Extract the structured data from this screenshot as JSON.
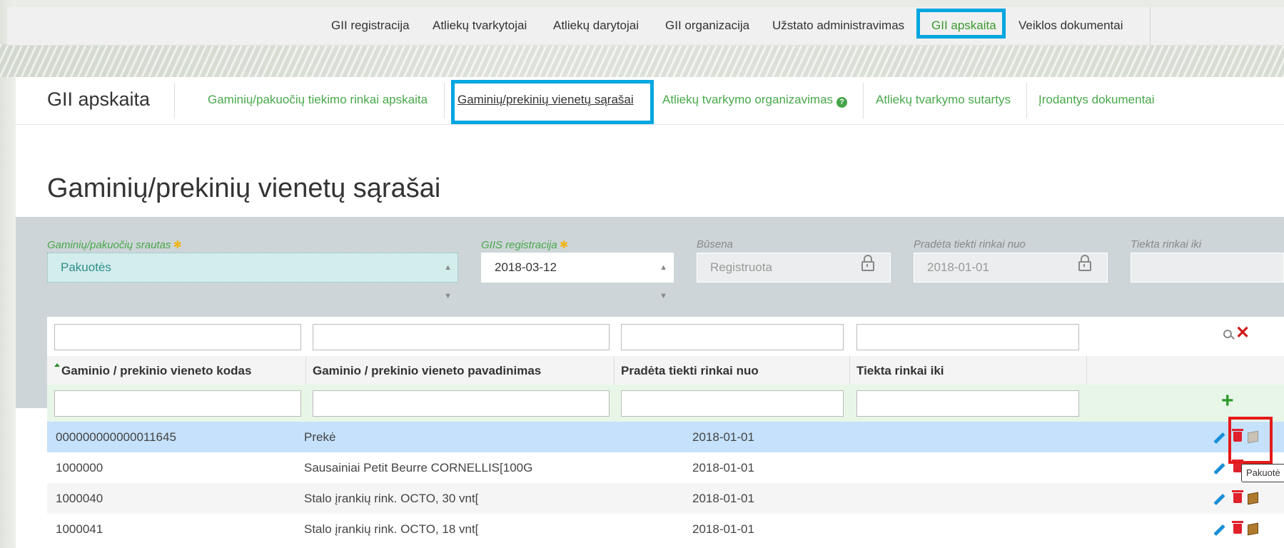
{
  "topnav": {
    "items": [
      {
        "label": "GII registracija"
      },
      {
        "label": "Atliekų tvarkytojai"
      },
      {
        "label": "Atliekų darytojai"
      },
      {
        "label": "GII organizacija"
      },
      {
        "label": "Užstato administravimas"
      },
      {
        "label": "GII apskaita",
        "active": true
      },
      {
        "label": "Veiklos dokumentai"
      }
    ]
  },
  "subnav": {
    "title": "GII apskaita",
    "items": [
      {
        "label": "Gaminių/pakuočių tiekimo rinkai apskaita"
      },
      {
        "label": "Gaminių/prekinių vienetų sąrašai",
        "current": true
      },
      {
        "label": "Atliekų tvarkymo organizavimas"
      },
      {
        "label": "Atliekų tvarkymo sutartys"
      },
      {
        "label": "Įrodantys dokumentai"
      }
    ],
    "help_badge": "?"
  },
  "page": {
    "title": "Gaminių/prekinių vienetų sąrašai"
  },
  "filters": {
    "stream": {
      "label": "Gaminių/pakuočių srautas",
      "value": "Pakuotės",
      "required_mark": "✱"
    },
    "registration": {
      "label": "GIIS registracija",
      "value": "2018-03-12",
      "required_mark": "✱"
    },
    "status": {
      "label": "Būsena",
      "value": "Registruota"
    },
    "supplied_from": {
      "label": "Pradėta tiekti rinkai nuo",
      "value": "2018-01-01"
    },
    "supplied_to": {
      "label": "Tiekta rinkai iki",
      "value": ""
    }
  },
  "table": {
    "columns": [
      "Gaminio / prekinio vieneto kodas",
      "Gaminio / prekinio vieneto pavadinimas",
      "Pradėta tiekti rinkai nuo",
      "Tiekta rinkai iki"
    ],
    "add_symbol": "+",
    "clear_symbol": "✕",
    "rows": [
      {
        "code": "000000000000011645",
        "name": "Prekė",
        "from": "2018-01-01",
        "to": ""
      },
      {
        "code": "1000000",
        "name": "Sausainiai Petit Beurre CORNELLIS[100G",
        "from": "2018-01-01",
        "to": ""
      },
      {
        "code": "1000040",
        "name": "Stalo įrankių rink. OCTO, 30 vnt[",
        "from": "2018-01-01",
        "to": ""
      },
      {
        "code": "1000041",
        "name": "Stalo įrankių rink. OCTO, 18 vnt[",
        "from": "2018-01-01",
        "to": ""
      }
    ]
  },
  "tooltip": {
    "text": "Pakuotė"
  },
  "colors": {
    "accent_green": "#48a84a",
    "highlight_blue": "#00a6e0",
    "highlight_red": "#e41a1a"
  }
}
